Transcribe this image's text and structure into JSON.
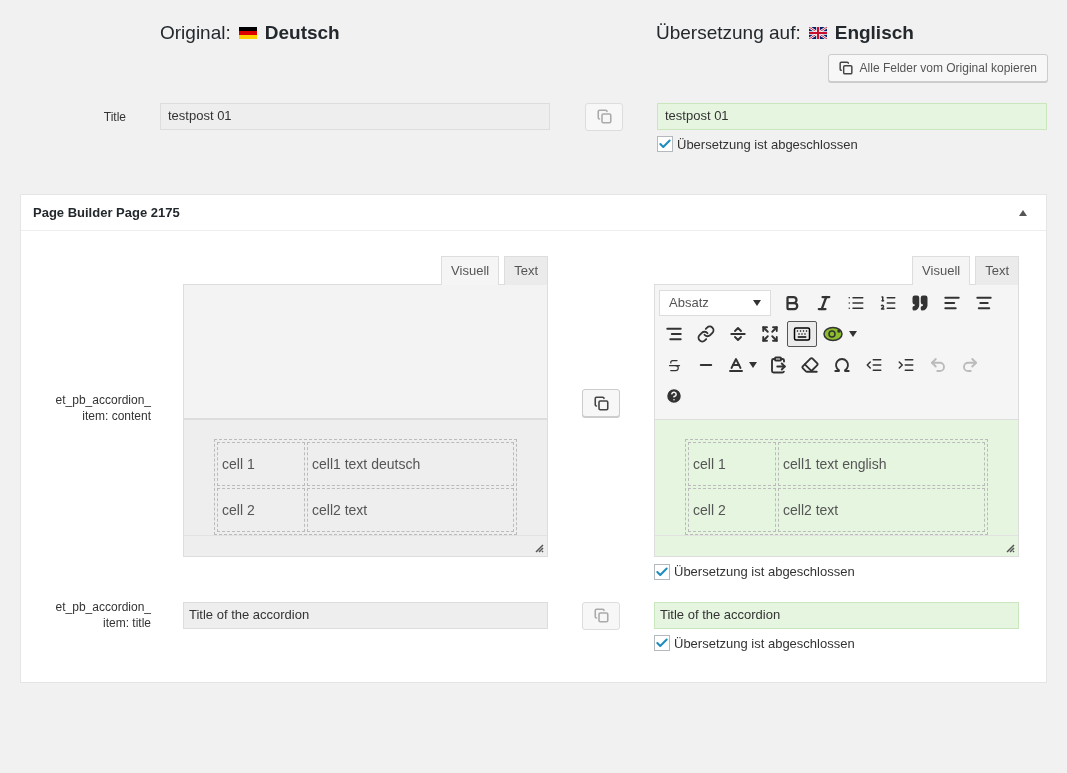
{
  "header": {
    "original": {
      "label": "Original:",
      "language": "Deutsch"
    },
    "translation": {
      "label": "Übersetzung auf:",
      "language": "Englisch"
    },
    "copy_all_button": "Alle Felder vom Original kopieren"
  },
  "title_field": {
    "label": "Title",
    "original": "testpost 01",
    "translation": "testpost 01",
    "copy_disabled": true,
    "completed": true,
    "completed_label": "Übersetzung ist abgeschlossen"
  },
  "panel": {
    "title": "Page Builder Page 2175",
    "expanded": true,
    "fields": [
      {
        "kind": "editor",
        "label_lines": [
          "et_pb_accordion_",
          "item: content"
        ],
        "copy_disabled": false,
        "completed": true,
        "completed_label": "Übersetzung ist abgeschlossen",
        "original": {
          "tabs": [
            {
              "label": "Visuell",
              "selected": true
            },
            {
              "label": "Text",
              "selected": false
            }
          ],
          "rows": [
            [
              "cell 1",
              "cell1 text deutsch"
            ],
            [
              "cell 2",
              "cell2 text"
            ]
          ]
        },
        "translation": {
          "tabs": [
            {
              "label": "Visuell",
              "selected": true
            },
            {
              "label": "Text",
              "selected": false
            }
          ],
          "rows": [
            [
              "cell 1",
              "cell1 text english"
            ],
            [
              "cell 2",
              "cell2 text"
            ]
          ],
          "toolbar": {
            "format": "Absatz",
            "toggle_on": true,
            "undo_enabled": false,
            "redo_enabled": false
          }
        }
      },
      {
        "kind": "text",
        "label_lines": [
          "et_pb_accordion_",
          "item: title"
        ],
        "copy_disabled": true,
        "completed": true,
        "completed_label": "Übersetzung ist abgeschlossen",
        "original": "Title of the accordion",
        "translation": "Title of the accordion"
      }
    ]
  }
}
